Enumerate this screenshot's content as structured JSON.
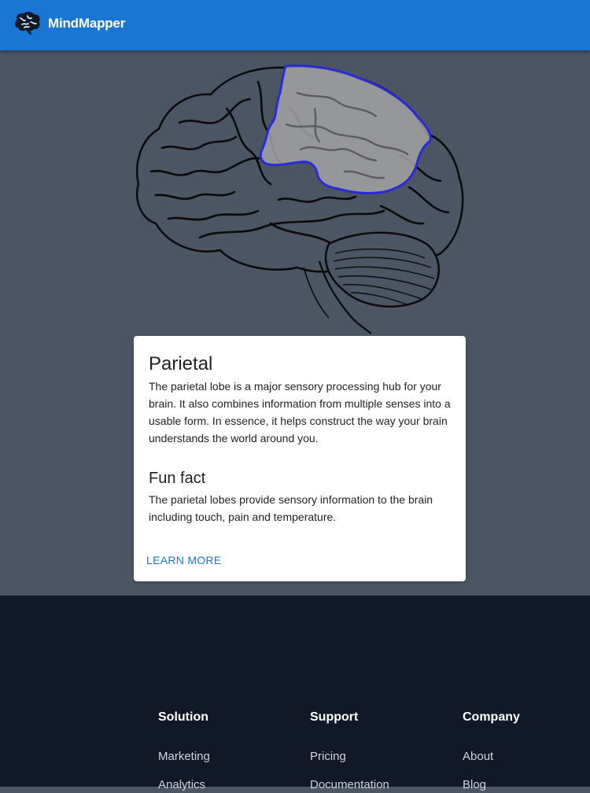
{
  "app": {
    "title": "MindMapper",
    "logo_icon": "brain-icon",
    "brand_color": "#1976d2"
  },
  "diagram": {
    "highlighted_region": "parietal",
    "highlight_stroke": "#2a2ad8",
    "highlight_fill": "#a3a3a3"
  },
  "card": {
    "title": "Parietal",
    "description": "The parietal lobe is a major sensory processing hub for your brain. It also combines information from multiple senses into a usable form. In essence, it helps construct the way your brain understands the world around you.",
    "fun_fact_heading": "Fun fact",
    "fun_fact": "The parietal lobes provide sensory information to the brain including touch, pain and temperature.",
    "learn_more": "LEARN MORE"
  },
  "footer": {
    "columns": [
      {
        "title": "Solution",
        "links": [
          "Marketing",
          "Analytics"
        ]
      },
      {
        "title": "Support",
        "links": [
          "Pricing",
          "Documentation"
        ]
      },
      {
        "title": "Company",
        "links": [
          "About",
          "Blog"
        ]
      }
    ]
  }
}
